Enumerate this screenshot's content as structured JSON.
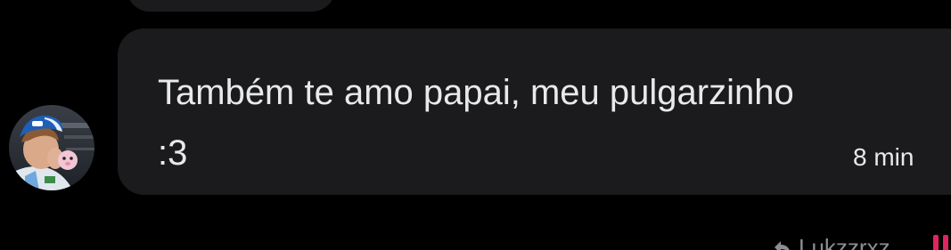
{
  "message": {
    "text": "Também te amo papai, meu pulgarzinho\n:3",
    "time": "8 min"
  },
  "reply_hint": {
    "username": "Lukzzrxz"
  },
  "icons": {
    "reply": "reply-arrow-icon",
    "alert": "exclamation-icon"
  },
  "colors": {
    "background": "#000000",
    "bubble": "#1b1b1d",
    "text": "#e7e9ea",
    "muted": "#8b8e92",
    "alert": "#e0245e"
  }
}
